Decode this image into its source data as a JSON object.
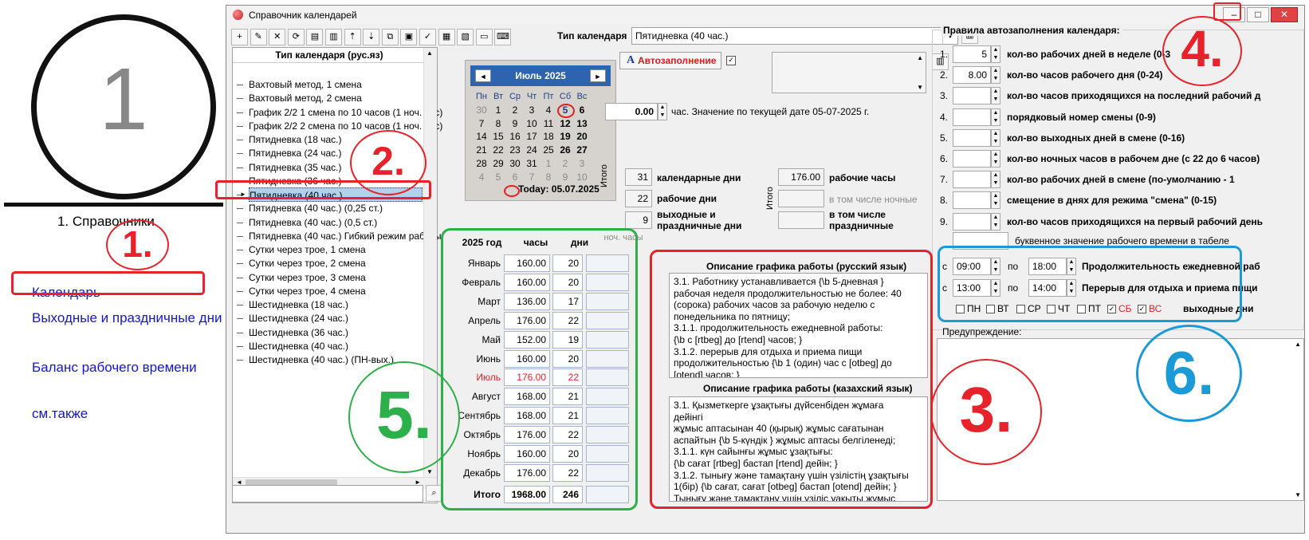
{
  "left": {
    "big_number": "1",
    "caption": "1. Справочники",
    "links": [
      "Календарь",
      "Выходные и праздничные дни",
      "Баланс рабочего времени",
      "см.также"
    ]
  },
  "annotations": [
    "1.",
    "2.",
    "3.",
    "4.",
    "5.",
    "6."
  ],
  "window": {
    "title": "Справочник календарей",
    "controls": {
      "minimize": "–",
      "restore": "□",
      "close": "✕"
    }
  },
  "toolbar": {
    "buttons": [
      "add-icon",
      "edit-icon",
      "delete-icon",
      "refresh-icon",
      "report-icon",
      "book-icon",
      "move-up-icon",
      "move-down-icon",
      "copy-icon",
      "paste-icon",
      "wizard-icon",
      "export-icon",
      "print-icon",
      "screen-icon",
      "keyboard-icon"
    ],
    "glyphs": [
      "+",
      "✎",
      "✕",
      "⟳",
      "▤",
      "▥",
      "⇡",
      "⇣",
      "⧉",
      "▣",
      "✓",
      "▦",
      "▧",
      "▭",
      "⌨"
    ]
  },
  "calendar_type": {
    "label": "Тип календаря",
    "value": "Пятидневка (40 час.)"
  },
  "list": {
    "header": "Тип календаря (рус.яз)",
    "items": [
      "Вахтовый метод, 1 смена",
      "Вахтовый метод, 2 смена",
      "График 2/2 1 смена по 10 часов (1 ноч. час)",
      "График 2/2 2 смена по 10 часов (1 ноч. час)",
      "Пятидневка (18 час.)",
      "Пятидневка (24 час.)",
      "Пятидневка (35 час.)",
      "Пятидневка (36 час.)",
      "Пятидневка (40 час.)",
      "Пятидневка (40 час.) (0,25 ст.)",
      "Пятидневка (40 час.) (0,5 ст.)",
      "Пятидневка (40 час.) Гибкий режим работы",
      "Сутки через трое, 1 смена",
      "Сутки через трое, 2 смена",
      "Сутки через трое, 3 смена",
      "Сутки через трое, 4 смена",
      "Шестидневка (18 час.)",
      "Шестидневка (24 час.)",
      "Шестидневка (36 час.)",
      "Шестидневка (40 час.)",
      "Шестидневка (40 час.) (ПН-вых.)"
    ],
    "selected_index": 8
  },
  "calendar": {
    "month_title": "Июль 2025",
    "prev": "◄",
    "next": "►",
    "weekdays": [
      "Пн",
      "Вт",
      "Ср",
      "Чт",
      "Пт",
      "Сб",
      "Вс"
    ],
    "weeks": [
      [
        "30",
        "1",
        "2",
        "3",
        "4",
        "5",
        "6"
      ],
      [
        "7",
        "8",
        "9",
        "10",
        "11",
        "12",
        "13"
      ],
      [
        "14",
        "15",
        "16",
        "17",
        "18",
        "19",
        "20"
      ],
      [
        "21",
        "22",
        "23",
        "24",
        "25",
        "26",
        "27"
      ],
      [
        "28",
        "29",
        "30",
        "31",
        "1",
        "2",
        "3"
      ],
      [
        "4",
        "5",
        "6",
        "7",
        "8",
        "9",
        "10"
      ]
    ],
    "today": "Today: 05.07.2025"
  },
  "autofill": {
    "button": "Автозаполнение",
    "checked": "✓"
  },
  "hours_field": {
    "value": "0.00",
    "text": "час. Значение по текущей дате 05-07-2025 г."
  },
  "totals": {
    "itogo": "Итого",
    "calendar_days": {
      "value": "31",
      "label": "календарные дни"
    },
    "work_days": {
      "value": "22",
      "label": "рабочие дни"
    },
    "holidays": {
      "value": "9",
      "label": "выходные и праздничные дни"
    },
    "work_hours": {
      "value": "176.00",
      "label": "рабочие часы"
    },
    "night_label": "в том числе ночные",
    "holiday_label": "в том числе праздничные"
  },
  "year_table": {
    "headers": [
      "2025 год",
      "часы",
      "дни",
      "ноч. часы"
    ],
    "rows": [
      {
        "month": "Январь",
        "hours": "160.00",
        "days": "20"
      },
      {
        "month": "Февраль",
        "hours": "160.00",
        "days": "20"
      },
      {
        "month": "Март",
        "hours": "136.00",
        "days": "17"
      },
      {
        "month": "Апрель",
        "hours": "176.00",
        "days": "22"
      },
      {
        "month": "Май",
        "hours": "152.00",
        "days": "19"
      },
      {
        "month": "Июнь",
        "hours": "160.00",
        "days": "20"
      },
      {
        "month": "Июль",
        "hours": "176.00",
        "days": "22"
      },
      {
        "month": "Август",
        "hours": "168.00",
        "days": "21"
      },
      {
        "month": "Сентябрь",
        "hours": "168.00",
        "days": "21"
      },
      {
        "month": "Октябрь",
        "hours": "176.00",
        "days": "22"
      },
      {
        "month": "Ноябрь",
        "hours": "160.00",
        "days": "20"
      },
      {
        "month": "Декабрь",
        "hours": "176.00",
        "days": "22"
      }
    ],
    "current_month_index": 6,
    "total": {
      "label": "Итого",
      "hours": "1968.00",
      "days": "246"
    }
  },
  "desc_ru": {
    "title": "Описание графика работы (русский язык)",
    "text": "3.1. Работнику устанавливается {\\b 5-дневная }\nрабочая неделя продолжительностью не более: 40\n(сорока) рабочих часов за рабочую неделю с\nпонедельника по пятницу;\n3.1.1. продолжительность ежедневной работы:\n{\\b с [rtbeg] до [rtend] часов; }\n3.1.2. перерыв для отдыха и приема пищи\nпродолжительностью {\\b 1 (один) час с [otbeg] до\n[otend] часов;  }"
  },
  "desc_kz": {
    "title": "Описание графика работы (казахский язык)",
    "text": "3.1. Қызметкерге ұзақтығы дүйсенбіден жұмаға дейінгі\nжұмыс аптасынан 40 (қырық) жұмыс сағатынан\nаспайтын {\\b 5-күндік } жұмыс аптасы белгіленеді;\n3.1.1. күн сайынғы жұмыс ұзақтығы:\n{\\b сағат [rtbeg] бастап [rtend] дейін; }\n3.1.2. тынығу және тамақтану үшін үзілістің ұзақтығы\n1(бір) {\\b сағат, сағат [otbeg] бастап [otend] дейін; }\nТынығу және тамақтану үшін үзіліс уақыты жұмыс\nуақытына кірмейді"
  },
  "rules": {
    "title": "Правила автозаполнения календаря:",
    "rows": [
      {
        "num": "1.",
        "value": "5",
        "text": "кол-во рабочих дней в неделе (0-3"
      },
      {
        "num": "2.",
        "value": "8.00",
        "text": "кол-во часов рабочего дня (0-24)"
      },
      {
        "num": "3.",
        "value": "",
        "text": "кол-во часов приходящихся на последний рабочий д"
      },
      {
        "num": "4.",
        "value": "",
        "text": "порядковый номер смены (0-9)"
      },
      {
        "num": "5.",
        "value": "",
        "text": "кол-во выходных дней в смене (0-16)"
      },
      {
        "num": "6.",
        "value": "",
        "text": "кол-во ночных часов в рабочем дне (с 22 до 6 часов)"
      },
      {
        "num": "7.",
        "value": "",
        "text": "кол-во рабочих дней в смене (по-умолчанию - 1"
      },
      {
        "num": "8.",
        "value": "",
        "text": "смещение в днях для режима \"смена\" (0-15)"
      },
      {
        "num": "9.",
        "value": "",
        "text": "кол-во часов приходящихся на первый рабочий день"
      }
    ],
    "letter_label": "буквенное значение рабочего времени в табеле"
  },
  "schedule": {
    "from": "с",
    "to": "по",
    "work": {
      "start": "09:00",
      "end": "18:00",
      "label": "Продолжительность ежедневной раб"
    },
    "break": {
      "start": "13:00",
      "end": "14:00",
      "label": "Перерыв для отдыха и приема пищи"
    },
    "days": [
      "ПН",
      "ВТ",
      "СР",
      "ЧТ",
      "ПТ",
      "СБ",
      "ВС"
    ],
    "checked_days": [
      "СБ",
      "ВС"
    ],
    "days_label": "выходные дни"
  },
  "warning": {
    "label": "Предупреждение:"
  },
  "colors": {
    "annot_red": "#e8222a",
    "annot_green": "#2bb04a",
    "annot_blue": "#1c9ad8",
    "selected_row": "#b3d0ee",
    "cal_header": "#2e63b0"
  }
}
